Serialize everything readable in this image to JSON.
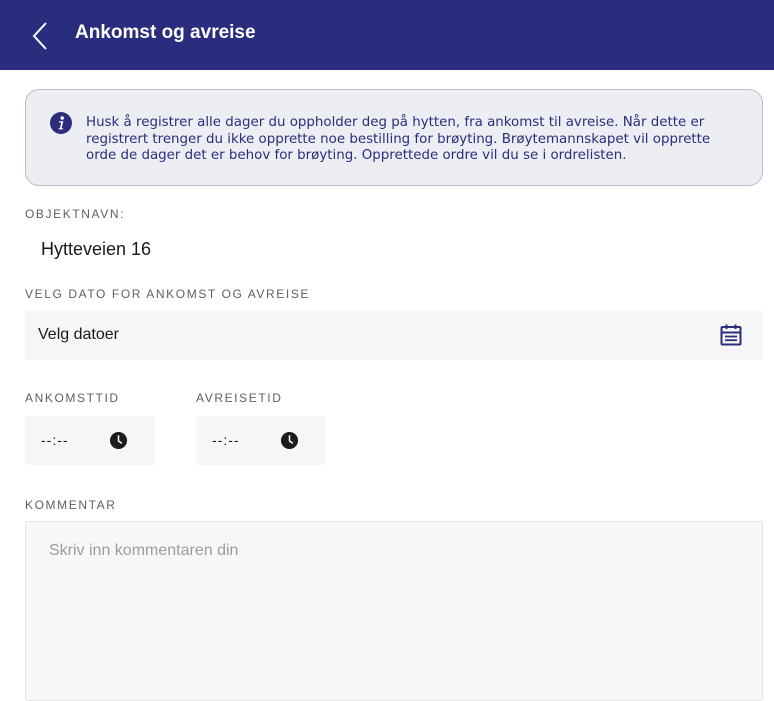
{
  "header": {
    "title": "Ankomst og avreise",
    "back_icon": "chevron-left-icon",
    "background": "#2a2d7d"
  },
  "info": {
    "icon": "info-icon",
    "lines": [
      "Husk å registrer alle dager du oppholder deg på hytten, fra ankomst til avreise. Når dette er",
      "registrert trenger du ikke opprette noe bestilling for brøyting. Brøytemannskapet vil opprette",
      "orde de dager det er behov for brøyting. Opprettede ordre vil du se i ordrelisten."
    ]
  },
  "object": {
    "label": "OBJEKTNAVN:",
    "value": "Hytteveien 16"
  },
  "dates": {
    "label": "VELG DATO FOR ANKOMST OG AVREISE",
    "field_text": "Velg datoer",
    "icon": "calendar-icon"
  },
  "arrival": {
    "label": "ANKOMSTTID",
    "value": "--:--",
    "icon": "clock-icon"
  },
  "departure": {
    "label": "AVREISETID",
    "value": "--:--",
    "icon": "clock-icon"
  },
  "comment": {
    "label": "KOMMENTAR",
    "placeholder": "Skriv inn kommentaren din"
  }
}
